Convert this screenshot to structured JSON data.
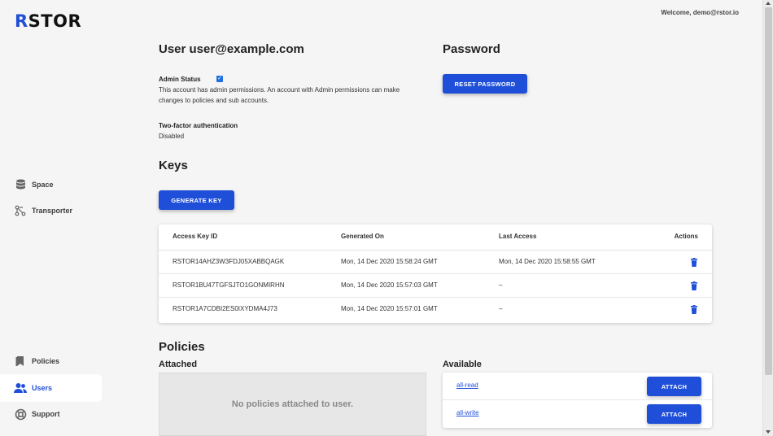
{
  "app": {
    "logo_first": "R",
    "logo_rest": "STOR"
  },
  "header": {
    "welcome": "Welcome, demo@rstor.io"
  },
  "sidebar": {
    "items": [
      {
        "label": "Space",
        "icon": "database-icon"
      },
      {
        "label": "Transporter",
        "icon": "transporter-icon"
      },
      {
        "label": "Policies",
        "icon": "bookmark-icon"
      },
      {
        "label": "Users",
        "icon": "users-icon",
        "active": true
      },
      {
        "label": "Support",
        "icon": "lifebuoy-icon"
      }
    ]
  },
  "user": {
    "title": "User user@example.com",
    "admin_label": "Admin Status",
    "admin_checked": true,
    "admin_desc_1": "This account has admin permissions. An account with Admin permissions can make",
    "admin_desc_2": "changes to policies and sub accounts.",
    "tfa_label": "Two-factor authentication",
    "tfa_value": "Disabled"
  },
  "password": {
    "title": "Password",
    "reset_label": "RESET PASSWORD"
  },
  "keys": {
    "title": "Keys",
    "generate_label": "GENERATE KEY",
    "columns": [
      "Access Key ID",
      "Generated On",
      "Last Access",
      "Actions"
    ],
    "rows": [
      {
        "id": "RSTOR14AHZ3W3FDJ05XABBQAGK",
        "generated": "Mon, 14 Dec 2020 15:58:24 GMT",
        "last": "Mon, 14 Dec 2020 15:58:55 GMT"
      },
      {
        "id": "RSTOR1BU47TGFSJTO1GONMIRHN",
        "generated": "Mon, 14 Dec 2020 15:57:03 GMT",
        "last": "–"
      },
      {
        "id": "RSTOR1A7CDBI2ES0IXYDMA4J73",
        "generated": "Mon, 14 Dec 2020 15:57:01 GMT",
        "last": "–"
      }
    ]
  },
  "policies": {
    "title": "Policies",
    "attached_label": "Attached",
    "attached_empty": "No policies attached to user.",
    "available_label": "Available",
    "available": [
      {
        "name": "all-read",
        "action": "ATTACH"
      },
      {
        "name": "all-write",
        "action": "ATTACH"
      }
    ]
  },
  "colors": {
    "accent": "#1f4fd8",
    "background": "#f5f5f5"
  }
}
